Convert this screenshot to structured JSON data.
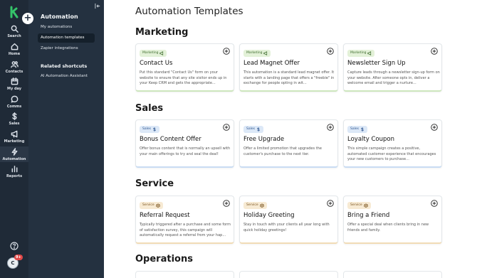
{
  "rail": {
    "items": [
      {
        "label": "Search",
        "icon": "search-icon"
      },
      {
        "label": "Home",
        "icon": "home-icon"
      },
      {
        "label": "Contacts",
        "icon": "contacts-icon"
      },
      {
        "label": "My day",
        "icon": "calendar-icon"
      },
      {
        "label": "Comms",
        "icon": "chat-icon"
      },
      {
        "label": "Sales",
        "icon": "dollar-icon"
      },
      {
        "label": "Marketing",
        "icon": "megaphone-icon"
      },
      {
        "label": "Automation",
        "icon": "lightning-icon"
      },
      {
        "label": "Reports",
        "icon": "bar-chart-icon"
      }
    ],
    "avatar_initial": "C",
    "avatar_badge": "9+"
  },
  "panel": {
    "title": "Automation",
    "links": [
      "My automations",
      "Automation templates",
      "Zapier integrations"
    ],
    "related_heading": "Related shortcuts",
    "related_links": [
      "AI Automation Assistant"
    ]
  },
  "main": {
    "title": "Automation Templates",
    "sections": [
      {
        "title": "Marketing",
        "cards": [
          {
            "tag": "Marketing",
            "title": "Contact Us",
            "desc": "Put this standard \"Contact Us\" form on your website to ensure that any site visitor ends up in your Keep CRM and gets the appropriate..."
          },
          {
            "tag": "Marketing",
            "title": "Lead Magnet Offer",
            "desc": "This automation is a standard lead magnet offer. It starts with a landing page that offers a \"freebie\" in exchange for people opting in wit..."
          },
          {
            "tag": "Marketing",
            "title": "Newsletter Sign Up",
            "desc": "Capture leads through a newsletter sign-up form on your website. After someone opts in, deliver a welcome email and trigger a nurture..."
          }
        ]
      },
      {
        "title": "Sales",
        "cards": [
          {
            "tag": "Sales",
            "title": "Bonus Content Offer",
            "desc": "Offer bonus content that is normally an upsell with your main offerings to try and seal the deal!"
          },
          {
            "tag": "Sales",
            "title": "Free Upgrade",
            "desc": "Offer a limited promotion that upgrades the customer's purchase to the next tier."
          },
          {
            "tag": "Sales",
            "title": "Loyalty Coupon",
            "desc": "This simple campaign creates a positive, automated customer experience that encourages your new customers to purchase..."
          }
        ]
      },
      {
        "title": "Service",
        "cards": [
          {
            "tag": "Service",
            "title": "Referral Request",
            "desc": "Typically triggered after a purchase and some form of satisfaction survey, this campaign will automatically request a referral from your hap..."
          },
          {
            "tag": "Service",
            "title": "Holiday Greeting",
            "desc": "Stay in touch with your clients all year long with quick holiday greetings!"
          },
          {
            "tag": "Service",
            "title": "Bring a Friend",
            "desc": "Offer a special deal when clients bring in new friends and family."
          }
        ]
      },
      {
        "title": "Operations",
        "cards": []
      }
    ]
  },
  "colors": {
    "rail_bg": "#1f2a37",
    "panel_bg": "#243140",
    "marketing_tag": "#e3f1d8",
    "sales_tag": "#dce8f7",
    "service_tag": "#f7ead3"
  }
}
